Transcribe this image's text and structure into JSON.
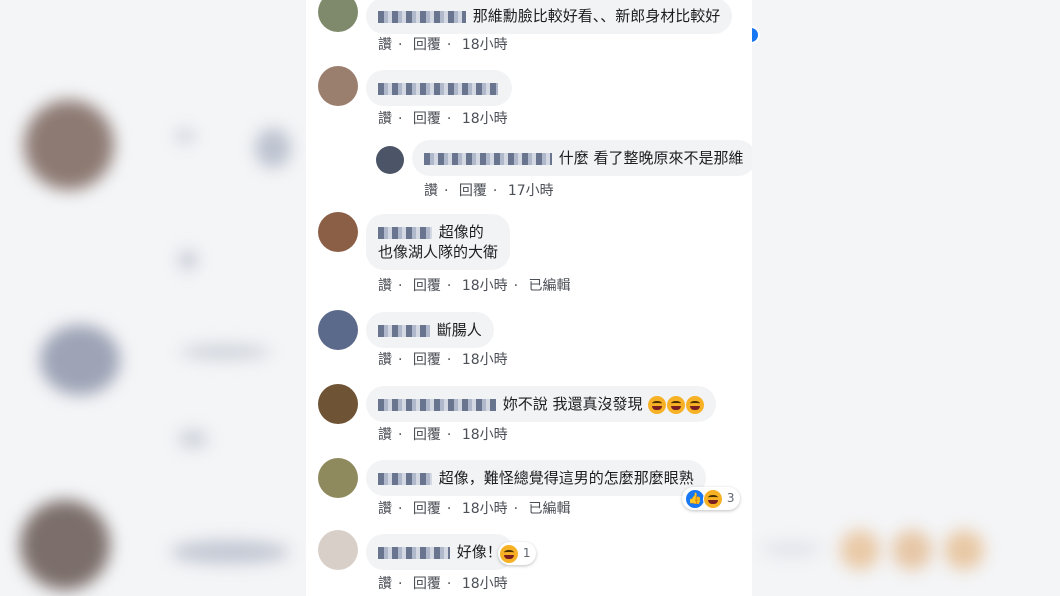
{
  "actions": {
    "like": "讚",
    "reply": "回覆",
    "sep": "·",
    "edited": "已編輯"
  },
  "comments": [
    {
      "text": "那維勳臉比較好看、、新郎身材比較好",
      "time": "18小時"
    },
    {
      "text": "",
      "time": "18小時"
    },
    {
      "text": "什麼 看了整晚原來不是那維",
      "time": "17小時"
    },
    {
      "text_line1": "超像的",
      "text_line2": "也像湖人隊的大衛",
      "time": "18小時"
    },
    {
      "text": "斷腸人",
      "time": "18小時"
    },
    {
      "text": "妳不說 我還真沒發現",
      "time": "18小時"
    },
    {
      "text": "超像，難怪總覺得這男的怎麼那麼眼熟",
      "time": "18小時",
      "reaction_count": "3"
    },
    {
      "text": "好像！",
      "time": "18小時",
      "reaction_count": "1"
    }
  ],
  "colors": {
    "bubble": "#f2f3f5",
    "text": "#1c1e21",
    "meta": "#4b4f56",
    "like": "#1877f2",
    "haha": "#f7b125"
  }
}
